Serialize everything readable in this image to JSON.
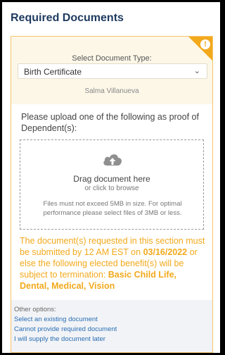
{
  "page": {
    "title": "Required Documents"
  },
  "select": {
    "label": "Select Document Type:",
    "value": "Birth Certificate",
    "person": "Salma Villanueva"
  },
  "upload": {
    "prompt": "Please upload one of the following as proof of Dependent(s):",
    "drag_title": "Drag document here",
    "drag_sub": "or click to browse",
    "note": "Files must not exceed 5MB in size. For optimal performance please select files of 3MB or less."
  },
  "warning": {
    "prefix": "The document(s) requested in this section must be submitted by 12 AM EST on ",
    "date": "03/16/2022",
    "middle": " or else the following elected benefit(s) will be subject to termination: ",
    "benefits": "Basic Child Life, Dental, Medical, Vision"
  },
  "other_options": {
    "label": "Other options:",
    "links": [
      "Select an existing document",
      "Cannot provide required document",
      "I will supply the document later"
    ]
  },
  "colors": {
    "accent": "#f2a91c",
    "title": "#1e3a5f",
    "link": "#2a6db5"
  },
  "icons": {
    "corner": "alert-icon",
    "dropdown": "chevron-down-icon",
    "upload": "cloud-upload-icon"
  }
}
